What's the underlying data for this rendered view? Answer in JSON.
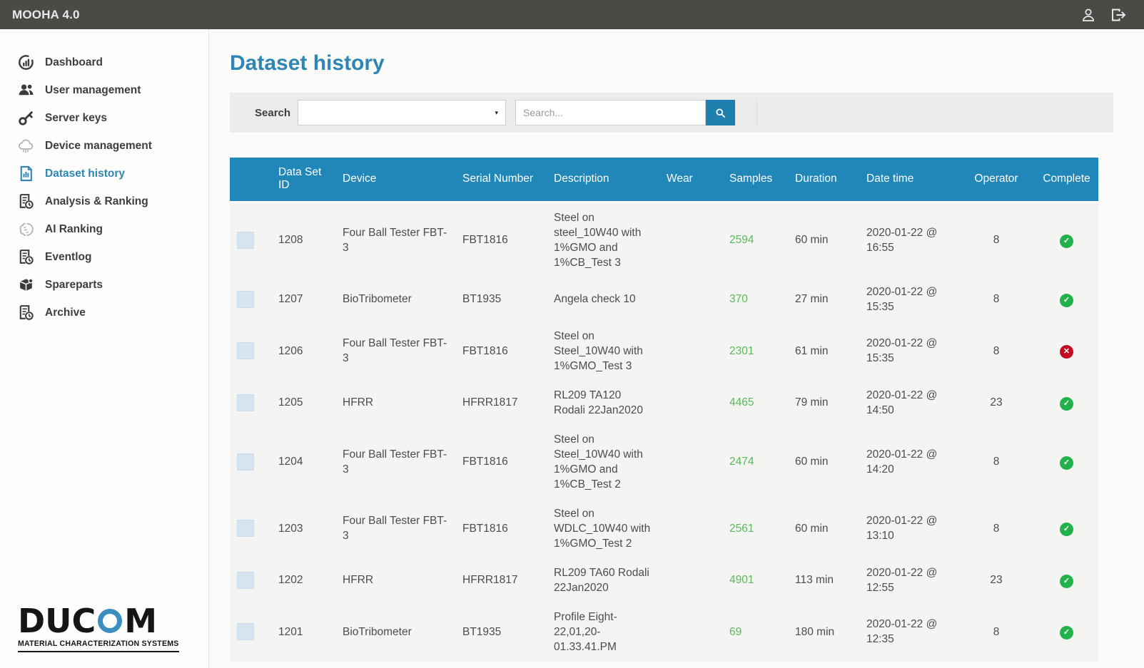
{
  "topbar": {
    "title": "MOOHA 4.0"
  },
  "sidebar": {
    "items": [
      {
        "label": "Dashboard",
        "icon": "dashboard"
      },
      {
        "label": "User management",
        "icon": "users"
      },
      {
        "label": "Server keys",
        "icon": "key"
      },
      {
        "label": "Device management",
        "icon": "cloud",
        "muted": true
      },
      {
        "label": "Dataset history",
        "icon": "doc-chart",
        "active": true
      },
      {
        "label": "Analysis & Ranking",
        "icon": "doc-clock"
      },
      {
        "label": "AI Ranking",
        "icon": "brain",
        "muted": true
      },
      {
        "label": "Eventlog",
        "icon": "doc-clock"
      },
      {
        "label": "Spareparts",
        "icon": "box"
      },
      {
        "label": "Archive",
        "icon": "doc-clock"
      }
    ],
    "logo": {
      "prefix": "DUC",
      "suffix": "M",
      "tagline": "MATERIAL CHARACTERIZATION SYSTEMS"
    }
  },
  "main": {
    "title": "Dataset history",
    "search": {
      "label": "Search",
      "filter_value": "",
      "placeholder": "Search..."
    },
    "table": {
      "columns": [
        "",
        "Data Set ID",
        "Device",
        "Serial Number",
        "Description",
        "Wear",
        "Samples",
        "Duration",
        "Date time",
        "Operator",
        "Complete"
      ],
      "rows": [
        {
          "id": "1208",
          "device": "Four Ball Tester FBT-3",
          "serial": "FBT1816",
          "description": "Steel on steel_10W40 with 1%GMO and 1%CB_Test 3",
          "wear": "",
          "samples": "2594",
          "duration": "60 min",
          "datetime": "2020-01-22 @ 16:55",
          "operator": "8",
          "complete": "success"
        },
        {
          "id": "1207",
          "device": "BioTribometer",
          "serial": "BT1935",
          "description": "Angela check 10",
          "wear": "",
          "samples": "370",
          "duration": "27 min",
          "datetime": "2020-01-22 @ 15:35",
          "operator": "8",
          "complete": "success"
        },
        {
          "id": "1206",
          "device": "Four Ball Tester FBT-3",
          "serial": "FBT1816",
          "description": "Steel on Steel_10W40 with 1%GMO_Test 3",
          "wear": "",
          "samples": "2301",
          "duration": "61 min",
          "datetime": "2020-01-22 @ 15:35",
          "operator": "8",
          "complete": "fail"
        },
        {
          "id": "1205",
          "device": "HFRR",
          "serial": "HFRR1817",
          "description": "RL209 TA120 Rodali 22Jan2020",
          "wear": "",
          "samples": "4465",
          "duration": "79 min",
          "datetime": "2020-01-22 @ 14:50",
          "operator": "23",
          "complete": "success"
        },
        {
          "id": "1204",
          "device": "Four Ball Tester FBT-3",
          "serial": "FBT1816",
          "description": "Steel on Steel_10W40 with 1%GMO and 1%CB_Test 2",
          "wear": "",
          "samples": "2474",
          "duration": "60 min",
          "datetime": "2020-01-22 @ 14:20",
          "operator": "8",
          "complete": "success"
        },
        {
          "id": "1203",
          "device": "Four Ball Tester FBT-3",
          "serial": "FBT1816",
          "description": "Steel on WDLC_10W40 with 1%GMO_Test 2",
          "wear": "",
          "samples": "2561",
          "duration": "60 min",
          "datetime": "2020-01-22 @ 13:10",
          "operator": "8",
          "complete": "success"
        },
        {
          "id": "1202",
          "device": "HFRR",
          "serial": "HFRR1817",
          "description": "RL209 TA60 Rodali 22Jan2020",
          "wear": "",
          "samples": "4901",
          "duration": "113 min",
          "datetime": "2020-01-22 @ 12:55",
          "operator": "23",
          "complete": "success"
        },
        {
          "id": "1201",
          "device": "BioTribometer",
          "serial": "BT1935",
          "description": "Profile Eight- 22,01,20- 01.33.41.PM",
          "wear": "",
          "samples": "69",
          "duration": "180 min",
          "datetime": "2020-01-22 @ 12:35",
          "operator": "8",
          "complete": "success"
        }
      ]
    }
  },
  "colors": {
    "topbar_gray": "#4a4a47",
    "table_header_blue": "#2186b8",
    "accent_blue": "#2e86b5",
    "search_button_blue": "#1f7fae",
    "samples_green": "#5cb85c",
    "status_green": "#21b24b",
    "status_red": "#c40a21",
    "checkbox_blue": "#d5e4ee"
  }
}
